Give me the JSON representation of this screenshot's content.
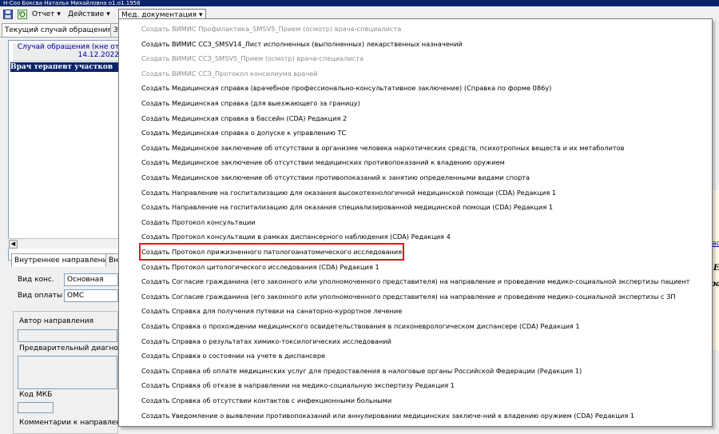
{
  "window": {
    "title": "Н-Соо Боксва Наталья Михайловна о1.о1.1958"
  },
  "toolbar": {
    "report_label": "Отчет",
    "action_label": "Действие",
    "meddoc_label": "Мед. документация"
  },
  "left_panel": {
    "tabs": [
      "Текущий случай обращения",
      "З"
    ],
    "case_header": "Случай обращения (кне от 14.12.2022",
    "tree_node": "Врач терапевт участков",
    "lower_tabs": [
      "Внутреннее направление",
      "Вн"
    ],
    "fields": {
      "cons_type_label": "Вид конс.",
      "cons_type_value": "Основная",
      "payment_label": "Вид оплаты",
      "payment_value": "ОМС",
      "author_label": "Автор направления",
      "diagnosis_label": "Предварительный диагноз",
      "mkb_label": "Код МКБ",
      "comments_label": "Комментарии к направлению"
    }
  },
  "right_edge": {
    "link_text": "ас",
    "letter_b": "Е",
    "letter_ra": "ра"
  },
  "menu": {
    "items": [
      {
        "label": "Создать ВИМИС Профилактика_SMSV5_Прием (осмотр) врача-специалиста",
        "disabled": true
      },
      {
        "label": "Создать ВИМИС ССЗ_SMSV14_Лист исполненных (выполненных) лекарственных назначений",
        "disabled": false
      },
      {
        "label": "Создать ВИМИС ССЗ_SMSV5_Прием (осмотр) врача-специалиста",
        "disabled": true
      },
      {
        "label": "Создать ВИМИС ССЗ_Протокол консилиума врачей",
        "disabled": true
      },
      {
        "label": "Создать Медицинская справка (врачебное профессионально-консультативное заключение) (Справка по форме 086у)",
        "disabled": false
      },
      {
        "label": "Создать Медицинская справка (для выезжающего за границу)",
        "disabled": false
      },
      {
        "label": "Создать Медицинская справка в бассейн (CDA) Редакция 2",
        "disabled": false
      },
      {
        "label": "Создать Медицинская справка о допуске к управлению ТС",
        "disabled": false
      },
      {
        "label": "Создать Медицинское заключение об отсутствии в организме человека наркотических средств, психотропных веществ и их метаболитов",
        "disabled": false
      },
      {
        "label": "Создать Медицинское заключение об отсутствии медицинских противопоказаний к владению оружием",
        "disabled": false
      },
      {
        "label": "Создать Медицинское заключение об отсутствии противопоказаний к занятию определенными видами спорта",
        "disabled": false
      },
      {
        "label": "Создать Направление на госпитализацию для оказания высокотехнологичной медицинской помощи (CDA) Редакция 1",
        "disabled": false
      },
      {
        "label": "Создать Направление на госпитализацию для оказания специализированной медицинской помощи (CDA) Редакция 1",
        "disabled": false
      },
      {
        "label": "Создать Протокол консультации",
        "disabled": false
      },
      {
        "label": "Создать Протокол консультации в рамках диспансерного наблюдения (CDA) Редакция 4",
        "disabled": false
      },
      {
        "label": "Создать Протокол прижизненного патологоанатомического исследования",
        "disabled": false,
        "highlighted": true
      },
      {
        "label": "Создать Протокол цитологического исследования (CDA) Редакция 1",
        "disabled": false
      },
      {
        "label": "Создать Согласие гражданина (его законного или уполномоченного представителя) на направление и проведение медико-социальной экспертизы пациент",
        "disabled": false
      },
      {
        "label": "Создать Согласие гражданина (его законного или уполномоченного представителя) на направление и проведение медико-социальной экспертизы с ЗП",
        "disabled": false
      },
      {
        "label": "Создать Справка для получения путевки на санаторно-курортное лечение",
        "disabled": false
      },
      {
        "label": "Создать Справка о прохождении медицинского освидетельствования в психоневрологическом диспансере (CDA) Редакция 1",
        "disabled": false
      },
      {
        "label": "Создать Справка о результатах химико-токсилогических исследований",
        "disabled": false
      },
      {
        "label": "Создать Справка о состоянии на учете в диспансере",
        "disabled": false
      },
      {
        "label": "Создать Справка об оплате медицинских услуг для предоставления в налоговые органы Российской Федерации (Редакция 1)",
        "disabled": false
      },
      {
        "label": "Создать Справка об отказе в направлении на медико-социальную экспертизу Редакция 1",
        "disabled": false
      },
      {
        "label": "Создать Справка об отсутствии контактов с инфекционными больными",
        "disabled": false
      },
      {
        "label": "Создать Уведомление о выявлении противопоказаний или аннулировании медицинских заключе-ний к владению оружием (CDA) Редакция 1",
        "disabled": false
      }
    ]
  },
  "colors": {
    "highlight_border": "#d41c1c",
    "disabled_text": "#8c8c8c",
    "title_bar": "#0a246a"
  }
}
